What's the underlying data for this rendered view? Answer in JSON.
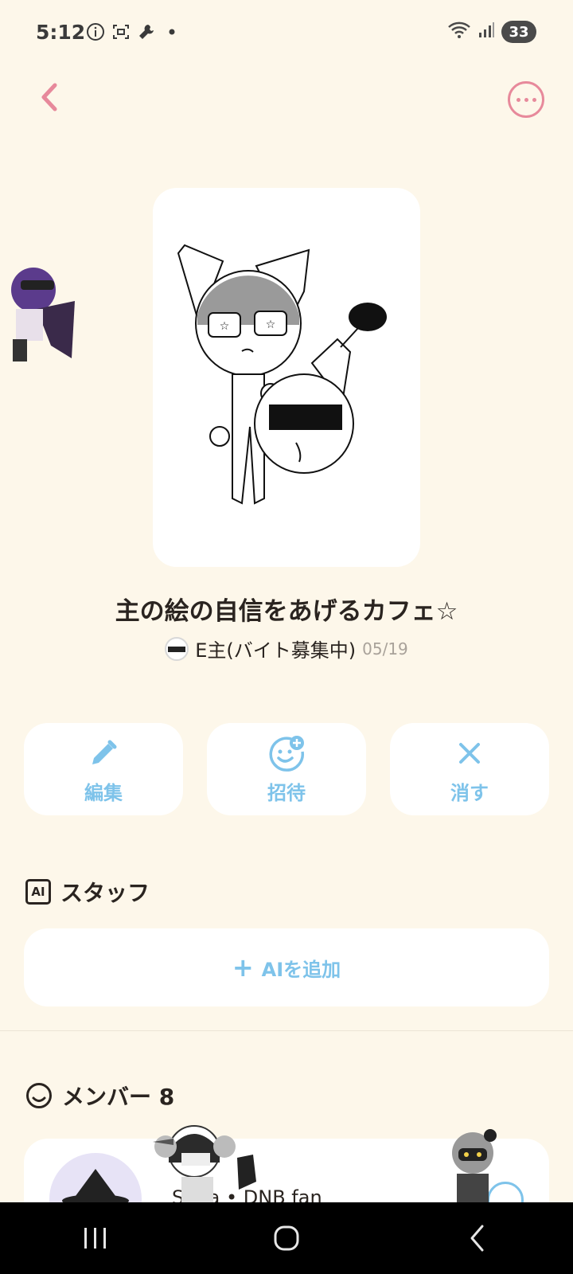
{
  "status_bar": {
    "time": "5:12",
    "battery": "33"
  },
  "header": {
    "back_icon": "chevron-left-icon",
    "more_icon": "more-horizontal-icon"
  },
  "room": {
    "title": "主の絵の自信をあげるカフェ☆",
    "owner_name": "E主(バイト募集中)",
    "date": "05/19"
  },
  "actions": [
    {
      "label": "編集",
      "icon": "pencil-icon"
    },
    {
      "label": "招待",
      "icon": "smile-plus-icon"
    },
    {
      "label": "消す",
      "icon": "close-icon"
    }
  ],
  "staff": {
    "heading": "スタッフ",
    "badge": "AI",
    "add_label": "AIを追加"
  },
  "members": {
    "heading": "メンバー 8",
    "first_name": "Shua • DNB fan"
  },
  "colors": {
    "background": "#fdf7ea",
    "accent_blue": "#7ec3ea",
    "accent_pink": "#e7899b"
  }
}
